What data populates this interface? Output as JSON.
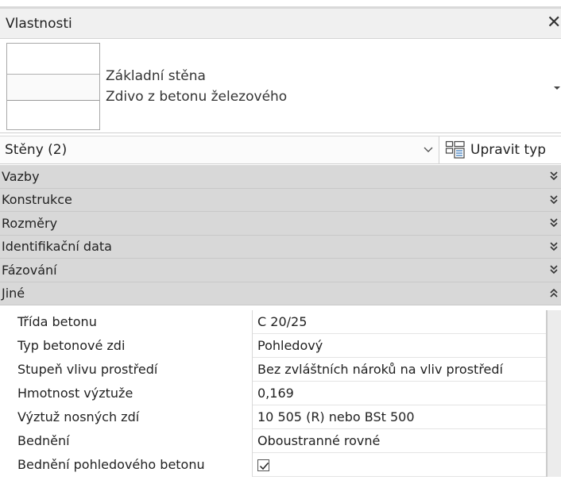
{
  "panel": {
    "title": "Vlastnosti",
    "close_glyph": "✕"
  },
  "type_selector": {
    "family": "Základní stěna",
    "type": "Zdivo z betonu železového",
    "icon": "wall-preview-icon"
  },
  "instance": {
    "selected": "Stěny (2)",
    "edit_type_label": "Upravit typ",
    "edit_type_icon": "edit-type-icon"
  },
  "groups": [
    {
      "label": "Vazby",
      "state": "collapsed"
    },
    {
      "label": "Konstrukce",
      "state": "collapsed"
    },
    {
      "label": "Rozměry",
      "state": "collapsed"
    },
    {
      "label": "Identifikační data",
      "state": "collapsed"
    },
    {
      "label": "Fázování",
      "state": "collapsed"
    },
    {
      "label": "Jiné",
      "state": "expanded"
    }
  ],
  "properties": [
    {
      "name": "Třída betonu",
      "value": "C 20/25"
    },
    {
      "name": "Typ betonové zdi",
      "value": "Pohledový"
    },
    {
      "name": "Stupeň vlivu prostředí",
      "value": "Bez zvláštních nároků na vliv prostředí"
    },
    {
      "name": "Hmotnost výztuže",
      "value": "0,169"
    },
    {
      "name": "Výztuž nosných zdí",
      "value": "10 505 (R) nebo BSt 500"
    },
    {
      "name": "Bednění",
      "value": "Oboustranné rovné"
    },
    {
      "name": "Bednění pohledového betonu",
      "value": "",
      "checked": true
    }
  ],
  "colors": {
    "group_bg": "#d8d8d8",
    "title_bg": "#f0f0f0"
  }
}
